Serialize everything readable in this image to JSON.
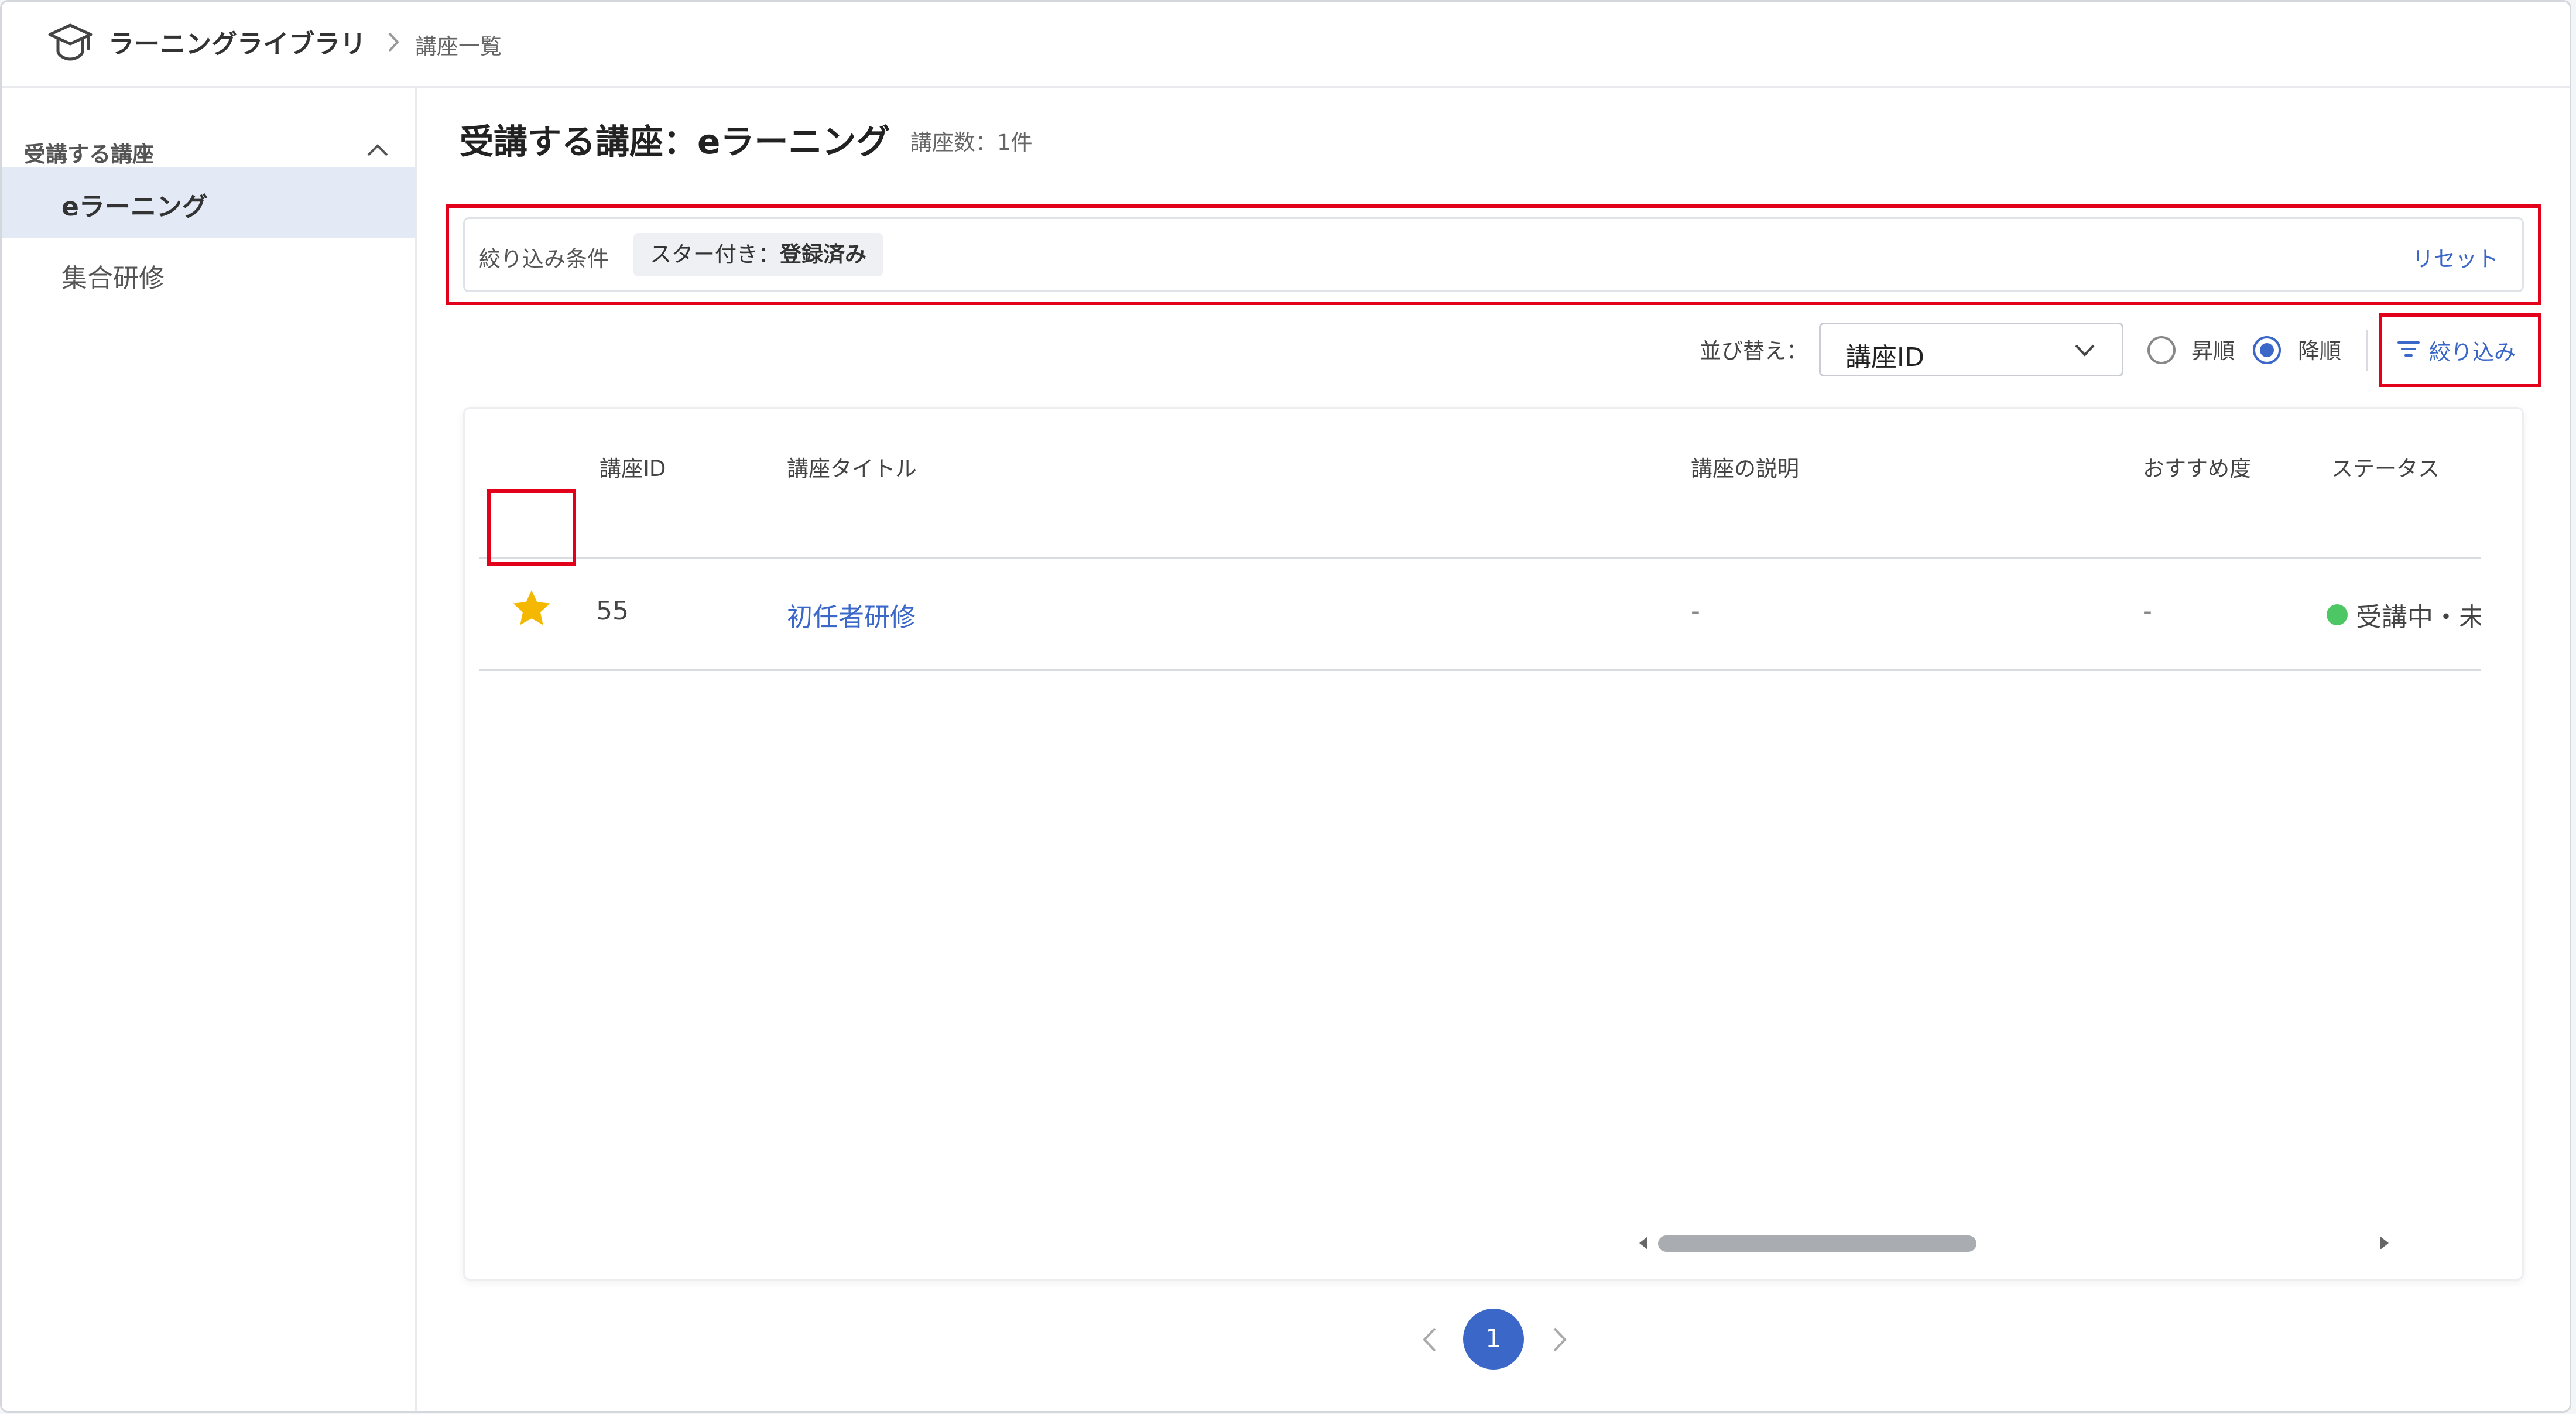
{
  "header": {
    "app_title": "ラーニングライブラリ",
    "breadcrumb_current": "講座一覧"
  },
  "sidebar": {
    "group_label": "受講する講座",
    "items": [
      {
        "label": "eラーニング",
        "active": true
      },
      {
        "label": "集合研修",
        "active": false
      }
    ]
  },
  "main": {
    "title": "受講する講座：eラーニング",
    "count_text": "講座数：1件",
    "filter": {
      "label": "絞り込み条件",
      "chip_prefix": "スター付き：",
      "chip_value": "登録済み",
      "reset_label": "リセット"
    },
    "sort": {
      "label": "並び替え：",
      "selected": "講座ID",
      "asc_label": "昇順",
      "desc_label": "降順",
      "order": "desc"
    },
    "filter_button_label": "絞り込み",
    "table": {
      "columns": [
        "講座ID",
        "講座タイトル",
        "講座の説明",
        "おすすめ度",
        "ステータス"
      ],
      "rows": [
        {
          "starred": true,
          "id": "55",
          "title": "初任者研修",
          "description": "-",
          "recommend": "-",
          "status": "受講中・未",
          "status_color": "#4cc764"
        }
      ]
    },
    "pagination": {
      "current": "1"
    }
  },
  "colors": {
    "accent": "#3a67c8",
    "star": "#f5b800",
    "highlight": "#e3001b"
  }
}
